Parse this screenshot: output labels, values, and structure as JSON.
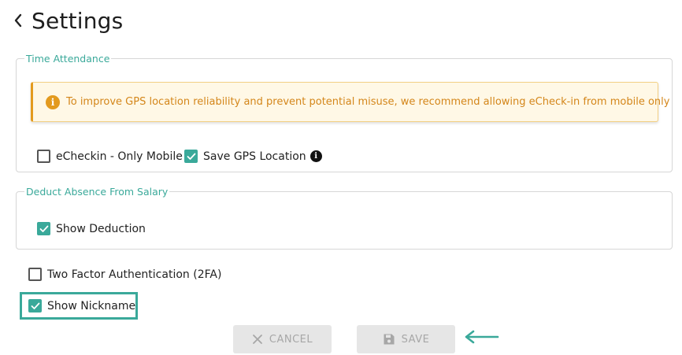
{
  "header": {
    "title": "Settings",
    "back_icon": "chevron-left-icon"
  },
  "time_attendance": {
    "legend": "Time Attendance",
    "alert": {
      "icon": "info-circle-icon",
      "text": "To improve GPS location reliability and prevent potential misuse, we recommend allowing eCheck-in from mobile only",
      "color": "#e39a1e"
    },
    "options": [
      {
        "label": "eCheckin - Only Mobile",
        "checked": false
      },
      {
        "label": "Save GPS Location",
        "checked": true
      }
    ]
  },
  "deduct_absence": {
    "legend": "Deduct Absence From Salary",
    "options": [
      {
        "label": "Show Deduction",
        "checked": true
      }
    ]
  },
  "general_options": [
    {
      "label": "Two Factor Authentication (2FA)",
      "checked": false
    },
    {
      "label": "Show Nickname",
      "checked": true
    }
  ],
  "actions": {
    "cancel_label": "CANCEL",
    "save_label": "SAVE",
    "disabled": true
  },
  "colors": {
    "accent": "#3aa99a",
    "warning": "#e39a1e"
  }
}
